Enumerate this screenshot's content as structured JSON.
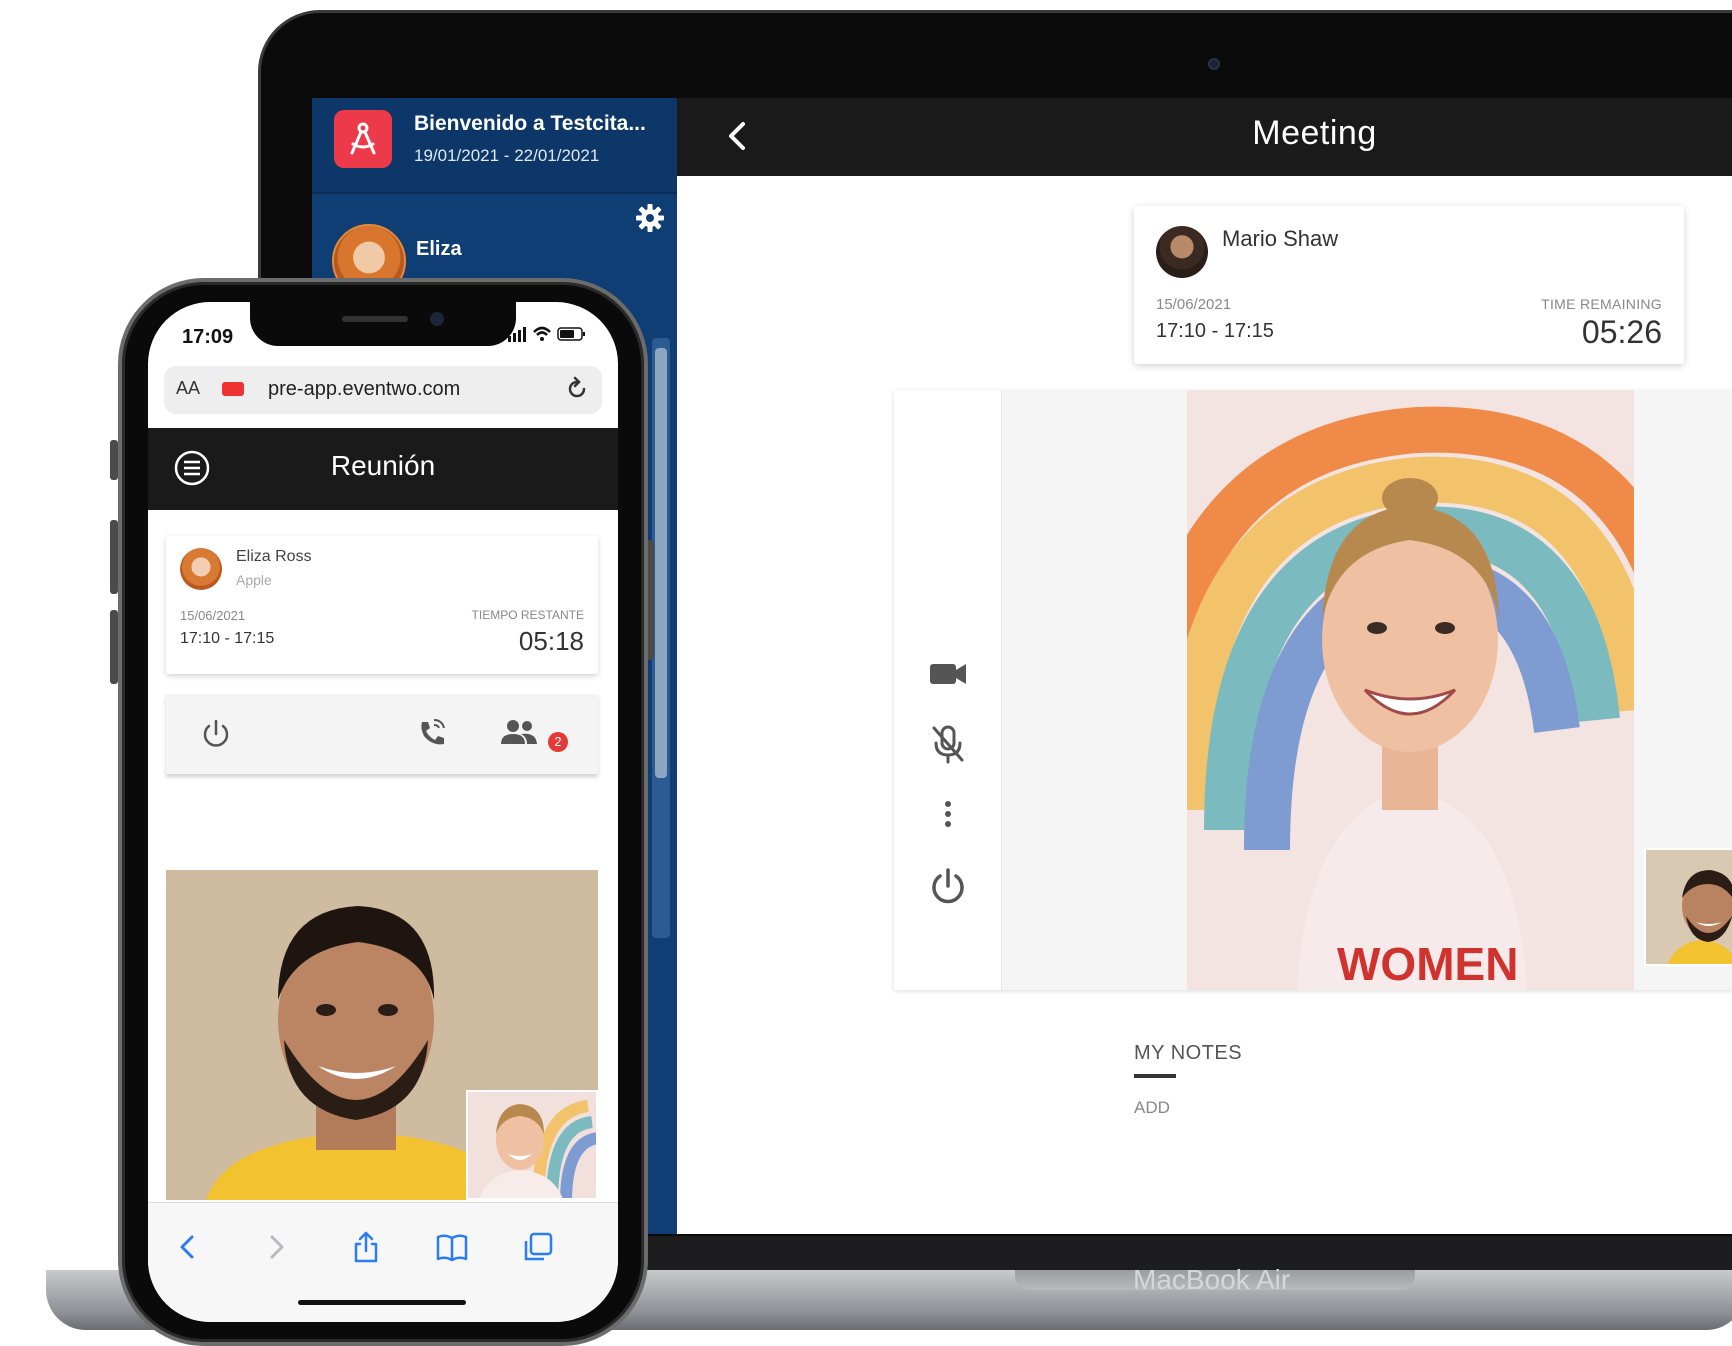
{
  "laptop": {
    "brand_label": "MacBook Air",
    "sidebar": {
      "event_title": "Bienvenido a Testcita...",
      "event_dates": "19/01/2021 - 22/01/2021",
      "user_name": "Eliza"
    },
    "topbar": {
      "title": "Meeting"
    },
    "meeting_card": {
      "contact_name": "Mario Shaw",
      "date": "15/06/2021",
      "time_range": "17:10 - 17:15",
      "remaining_label": "TIME REMAINING",
      "remaining": "05:26"
    },
    "notes": {
      "tab_label": "MY NOTES",
      "add_label": "ADD"
    }
  },
  "phone": {
    "status_time": "17:09",
    "url": {
      "aa_label": "AA",
      "address": "pre-app.eventwo.com"
    },
    "appbar": {
      "title": "Reunión"
    },
    "meeting_card": {
      "contact_name": "Eliza Ross",
      "company": "Apple",
      "date": "15/06/2021",
      "time_range": "17:10 - 17:15",
      "remaining_label": "TIEMPO RESTANTE",
      "remaining": "05:18"
    },
    "participants_badge": "2"
  },
  "colors": {
    "sidebar_blue": "#0f3e75",
    "topbar_dark": "#1a1a1a",
    "logo_red": "#ec3a4a",
    "badge_red": "#e53935"
  },
  "icons": {
    "logo": "compass-icon",
    "settings": "gear-icon",
    "back": "chevron-left-icon",
    "camera": "video-camera-icon",
    "mic": "mic-off-icon",
    "more": "more-vertical-icon",
    "hangup": "power-icon",
    "menu": "menu-icon",
    "reload": "reload-icon",
    "call": "phone-call-icon",
    "participants": "people-icon"
  }
}
